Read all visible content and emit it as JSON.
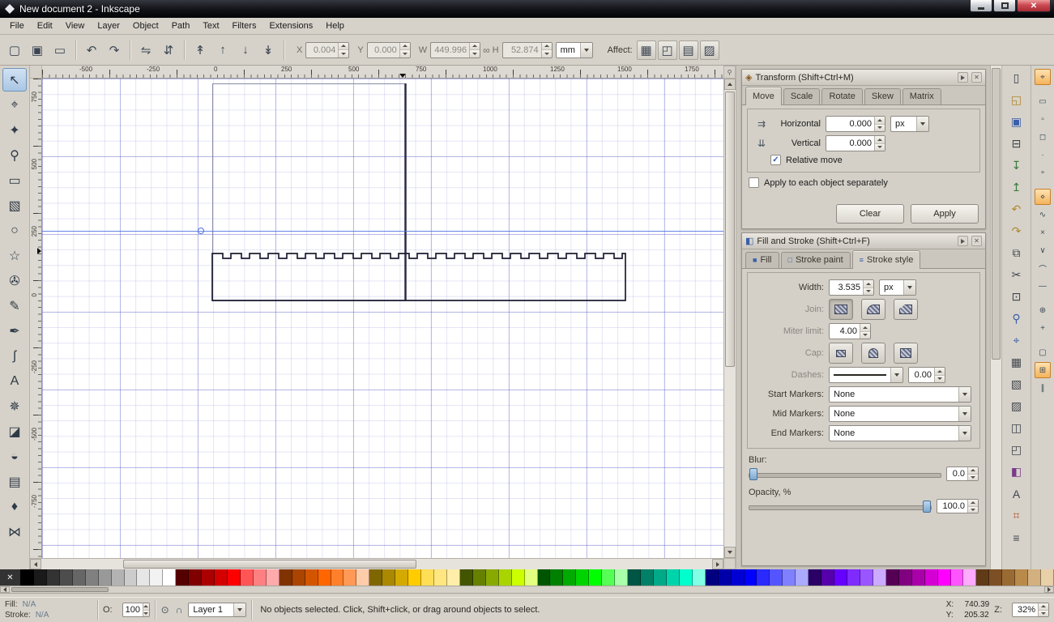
{
  "window": {
    "title": "New document 2 - Inkscape"
  },
  "ui": {
    "close_glyph": "✕",
    "check_glyph": "✓"
  },
  "menu": {
    "items": [
      "File",
      "Edit",
      "View",
      "Layer",
      "Object",
      "Path",
      "Text",
      "Filters",
      "Extensions",
      "Help"
    ]
  },
  "toolbar": {
    "buttons": [
      {
        "name": "select-all",
        "glyph": "▢"
      },
      {
        "name": "select-all-layers",
        "glyph": "▣"
      },
      {
        "name": "deselect",
        "glyph": "▭"
      },
      {
        "name": "rotate-90-ccw",
        "glyph": "↶"
      },
      {
        "name": "rotate-90-cw",
        "glyph": "↷"
      },
      {
        "name": "flip-horizontal",
        "glyph": "⇋"
      },
      {
        "name": "flip-vertical",
        "glyph": "⇵"
      },
      {
        "name": "raise-to-top",
        "glyph": "↟"
      },
      {
        "name": "raise",
        "glyph": "↑"
      },
      {
        "name": "lower",
        "glyph": "↓"
      },
      {
        "name": "lower-to-bottom",
        "glyph": "↡"
      }
    ],
    "fields": {
      "x_label": "X",
      "x_value": "0.004",
      "y_label": "Y",
      "y_value": "0.000",
      "w_label": "W",
      "w_value": "449.996",
      "lock_glyph": "∞",
      "h_label": "H",
      "h_value": "52.874",
      "unit": "mm"
    },
    "affect_label": "Affect:",
    "affect_buttons": [
      {
        "name": "scale-stroke-width",
        "glyph": "▦"
      },
      {
        "name": "scale-rounded-corners",
        "glyph": "◰"
      },
      {
        "name": "transform-gradients",
        "glyph": "▤"
      },
      {
        "name": "transform-patterns",
        "glyph": "▨"
      }
    ]
  },
  "toolbox": {
    "tools": [
      {
        "name": "selector-tool",
        "glyph": "↖"
      },
      {
        "name": "node-tool",
        "glyph": "⌖"
      },
      {
        "name": "tweak-tool",
        "glyph": "✦"
      },
      {
        "name": "zoom-tool",
        "glyph": "⚲"
      },
      {
        "name": "rectangle-tool",
        "glyph": "▭"
      },
      {
        "name": "box3d-tool",
        "glyph": "▧"
      },
      {
        "name": "ellipse-tool",
        "glyph": "○"
      },
      {
        "name": "star-tool",
        "glyph": "☆"
      },
      {
        "name": "spiral-tool",
        "glyph": "✇"
      },
      {
        "name": "pencil-tool",
        "glyph": "✎"
      },
      {
        "name": "bezier-tool",
        "glyph": "✒"
      },
      {
        "name": "calligraphy-tool",
        "glyph": "ʃ"
      },
      {
        "name": "text-tool",
        "glyph": "A"
      },
      {
        "name": "spray-tool",
        "glyph": "✵"
      },
      {
        "name": "eraser-tool",
        "glyph": "◪"
      },
      {
        "name": "bucket-tool",
        "glyph": "◒"
      },
      {
        "name": "gradient-tool",
        "glyph": "▤"
      },
      {
        "name": "dropper-tool",
        "glyph": "♦"
      },
      {
        "name": "connector-tool",
        "glyph": "⋈"
      }
    ]
  },
  "rulers": {
    "h_labels": [
      "-500",
      "-250",
      "0",
      "250",
      "500",
      "750",
      "1000",
      "1250",
      "1500",
      "1750"
    ],
    "v_labels": [
      "750",
      "500",
      "250",
      "0",
      "-250",
      "-500",
      "-750"
    ]
  },
  "panels": {
    "transform": {
      "icon": "◈",
      "title": "Transform (Shift+Ctrl+M)",
      "tabs": [
        "Move",
        "Scale",
        "Rotate",
        "Skew",
        "Matrix"
      ],
      "active_tab": "Move",
      "move_h_icon": "⇉",
      "move_v_icon": "⇊",
      "horizontal_label": "Horizontal",
      "horizontal_value": "0.000",
      "vertical_label": "Vertical",
      "vertical_value": "0.000",
      "unit": "px",
      "relative_move_label": "Relative move",
      "apply_each_label": "Apply to each object separately",
      "clear_label": "Clear",
      "apply_label": "Apply"
    },
    "fill_stroke": {
      "icon": "◧",
      "title": "Fill and Stroke (Shift+Ctrl+F)",
      "tabs": [
        {
          "label": "Fill",
          "icon": "■"
        },
        {
          "label": "Stroke paint",
          "icon": "□"
        },
        {
          "label": "Stroke style",
          "icon": "≡"
        }
      ],
      "active_tab": "Stroke style",
      "width_label": "Width:",
      "width_value": "3.535",
      "width_unit": "px",
      "join_label": "Join:",
      "miter_label": "Miter limit:",
      "miter_value": "4.00",
      "cap_label": "Cap:",
      "dashes_label": "Dashes:",
      "dash_offset": "0.00",
      "start_markers_label": "Start Markers:",
      "start_markers_value": "None",
      "mid_markers_label": "Mid Markers:",
      "mid_markers_value": "None",
      "end_markers_label": "End Markers:",
      "end_markers_value": "None",
      "blur_label": "Blur:",
      "blur_value": "0.0",
      "opacity_label": "Opacity, %",
      "opacity_value": "100.0"
    }
  },
  "commands": [
    {
      "name": "document-new",
      "glyph": "▯"
    },
    {
      "name": "document-open",
      "glyph": "◱",
      "color": "#b08830"
    },
    {
      "name": "document-save",
      "glyph": "▣",
      "color": "#3a5fa8"
    },
    {
      "name": "print",
      "glyph": "⊟"
    },
    {
      "name": "import",
      "glyph": "↧",
      "color": "#3a7a3a"
    },
    {
      "name": "export",
      "glyph": "↥",
      "color": "#3a7a3a"
    },
    {
      "name": "undo",
      "glyph": "↶",
      "color": "#b08830"
    },
    {
      "name": "redo",
      "glyph": "↷",
      "color": "#b08830"
    },
    {
      "name": "copy",
      "glyph": "⧉"
    },
    {
      "name": "cut",
      "glyph": "✂"
    },
    {
      "name": "paste",
      "glyph": "⊡"
    },
    {
      "name": "zoom-drawing",
      "glyph": "⚲",
      "color": "#3a5fa8"
    },
    {
      "name": "zoom-selection",
      "glyph": "⌖",
      "color": "#3a5fa8"
    },
    {
      "name": "duplicate",
      "glyph": "▦"
    },
    {
      "name": "create-clone",
      "glyph": "▧"
    },
    {
      "name": "unlink-clone",
      "glyph": "▨"
    },
    {
      "name": "group",
      "glyph": "◫"
    },
    {
      "name": "ungroup",
      "glyph": "◰"
    },
    {
      "name": "fill-stroke-dialog",
      "glyph": "◧",
      "color": "#7a3a8a"
    },
    {
      "name": "text-dialog",
      "glyph": "A"
    },
    {
      "name": "xml-editor",
      "glyph": "⌗",
      "color": "#b05030"
    },
    {
      "name": "align-dialog",
      "glyph": "≡"
    }
  ],
  "snap": [
    {
      "name": "snap-enable",
      "glyph": "⌖",
      "active": true
    },
    {
      "name": "snap-bbox",
      "glyph": "▭",
      "gap": true
    },
    {
      "name": "bbox-edges",
      "glyph": "▫"
    },
    {
      "name": "bbox-corners",
      "glyph": "◻"
    },
    {
      "name": "bbox-edge-midpoints",
      "glyph": "·"
    },
    {
      "name": "bbox-centers",
      "glyph": "∘"
    },
    {
      "name": "snap-nodes",
      "glyph": "⋄",
      "gap": true,
      "active": true
    },
    {
      "name": "snap-paths",
      "glyph": "∿"
    },
    {
      "name": "path-intersections",
      "glyph": "×"
    },
    {
      "name": "cusp-nodes",
      "glyph": "∨"
    },
    {
      "name": "smooth-nodes",
      "glyph": "⌒"
    },
    {
      "name": "line-midpoints",
      "glyph": "—"
    },
    {
      "name": "object-centers",
      "glyph": "⊕",
      "gap": true
    },
    {
      "name": "rotation-centers",
      "glyph": "+"
    },
    {
      "name": "snap-page-border",
      "glyph": "▢",
      "gap": true
    },
    {
      "name": "snap-grid",
      "glyph": "⊞",
      "active": true
    },
    {
      "name": "snap-guides",
      "glyph": "∥"
    }
  ],
  "palette": {
    "none_glyph": "✕",
    "colors": [
      "#000000",
      "#1a1a1a",
      "#333333",
      "#4d4d4d",
      "#666666",
      "#808080",
      "#999999",
      "#b3b3b3",
      "#cccccc",
      "#e6e6e6",
      "#f2f2f2",
      "#ffffff",
      "#550000",
      "#800000",
      "#aa0000",
      "#d40000",
      "#ff0000",
      "#ff5555",
      "#ff8080",
      "#ffaaaa",
      "#803300",
      "#aa4400",
      "#d45500",
      "#ff6600",
      "#ff7f2a",
      "#ff9955",
      "#ffccaa",
      "#806600",
      "#aa8800",
      "#d4aa00",
      "#ffcc00",
      "#ffdd55",
      "#ffe680",
      "#ffeeaa",
      "#445500",
      "#668000",
      "#88aa00",
      "#aad400",
      "#ccff00",
      "#e3ff80",
      "#005500",
      "#008000",
      "#00aa00",
      "#00d400",
      "#00ff00",
      "#55ff55",
      "#aaffaa",
      "#005544",
      "#008066",
      "#00aa88",
      "#00d4aa",
      "#00ffcc",
      "#80ffe6",
      "#000080",
      "#0000aa",
      "#0000d4",
      "#0000ff",
      "#2a2aff",
      "#5555ff",
      "#8080ff",
      "#aaaaff",
      "#2b0066",
      "#5500aa",
      "#6600ff",
      "#7f2aff",
      "#9955ff",
      "#ccaaff",
      "#550055",
      "#800080",
      "#aa00aa",
      "#d400d4",
      "#ff00ff",
      "#ff55ff",
      "#ffaaff",
      "#613a17",
      "#7d4f24",
      "#9a6a33",
      "#b98a49",
      "#d3b07f",
      "#e8d0a9"
    ]
  },
  "statusbar": {
    "fill_label": "Fill:",
    "fill_value": "N/A",
    "stroke_label": "Stroke:",
    "stroke_value": "N/A",
    "opacity_label": "O:",
    "opacity_value": "100",
    "eye_glyph": "⊙",
    "lock_glyph": "∩",
    "layer_name": "Layer 1",
    "message": "No objects selected. Click, Shift+click, or drag around objects to select.",
    "x_label": "X:",
    "x_value": "740.39",
    "y_label": "Y:",
    "y_value": "205.32",
    "z_label": "Z:",
    "zoom_value": "32%"
  }
}
